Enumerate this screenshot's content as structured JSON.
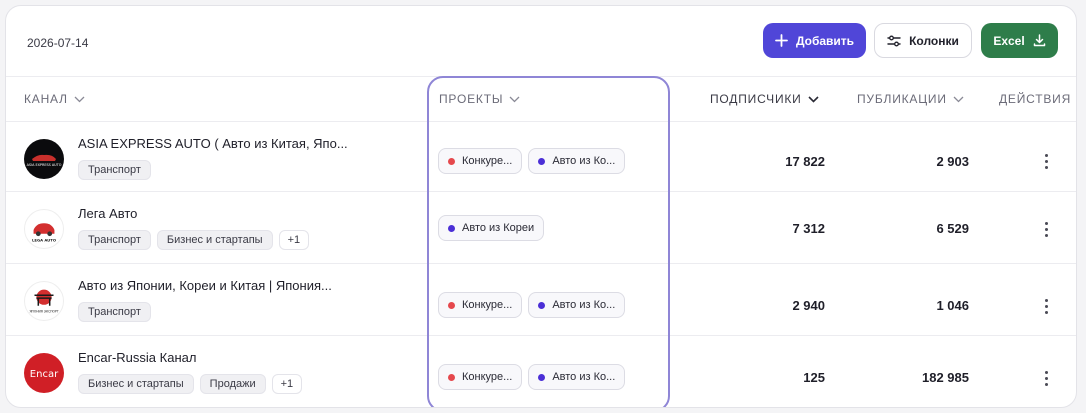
{
  "toolbar": {
    "date": "2026-07-14",
    "add_label": "Добавить",
    "columns_label": "Колонки",
    "excel_label": "Excel"
  },
  "headers": {
    "channel": "КАНАЛ",
    "projects": "ПРОЕКТЫ",
    "subscribers": "ПОДПИСЧИКИ",
    "publications": "ПУБЛИКАЦИИ",
    "actions": "ДЕЙСТВИЯ"
  },
  "rows": [
    {
      "name": "ASIA EXPRESS AUTO ( Авто из Китая, Япо...",
      "logo_text": "ASIA EXPRESS AUTO",
      "tags": [
        "Транспорт"
      ],
      "projects": [
        {
          "label": "Конкуре...",
          "color": "#e5484d"
        },
        {
          "label": "Авто из Ко...",
          "color": "#4b2fd6"
        }
      ],
      "subscribers": "17 822",
      "publications": "2 903"
    },
    {
      "name": "Лега Авто",
      "logo_text": "LEGA AUTO",
      "tags": [
        "Транспорт",
        "Бизнес и стартапы"
      ],
      "more": "+1",
      "projects": [
        {
          "label": "Авто из Кореи",
          "color": "#4b2fd6"
        }
      ],
      "subscribers": "7 312",
      "publications": "6 529"
    },
    {
      "name": "Авто из Японии, Кореи и Китая | Япония...",
      "logo_text": "ЯПОНИЯ ЭКСПОРТ",
      "tags": [
        "Транспорт"
      ],
      "projects": [
        {
          "label": "Конкуре...",
          "color": "#e5484d"
        },
        {
          "label": "Авто из Ко...",
          "color": "#4b2fd6"
        }
      ],
      "subscribers": "2 940",
      "publications": "1 046"
    },
    {
      "name": "Encar-Russia Канал",
      "logo_text": "Encar",
      "tags": [
        "Бизнес и стартапы",
        "Продажи"
      ],
      "more": "+1",
      "projects": [
        {
          "label": "Конкуре...",
          "color": "#e5484d"
        },
        {
          "label": "Авто из Ко...",
          "color": "#4b2fd6"
        }
      ],
      "subscribers": "125",
      "publications": "182 985"
    }
  ],
  "colors": {
    "primary": "#5046d8",
    "excel": "#2e7d4a",
    "highlight": "#8f86d6"
  }
}
